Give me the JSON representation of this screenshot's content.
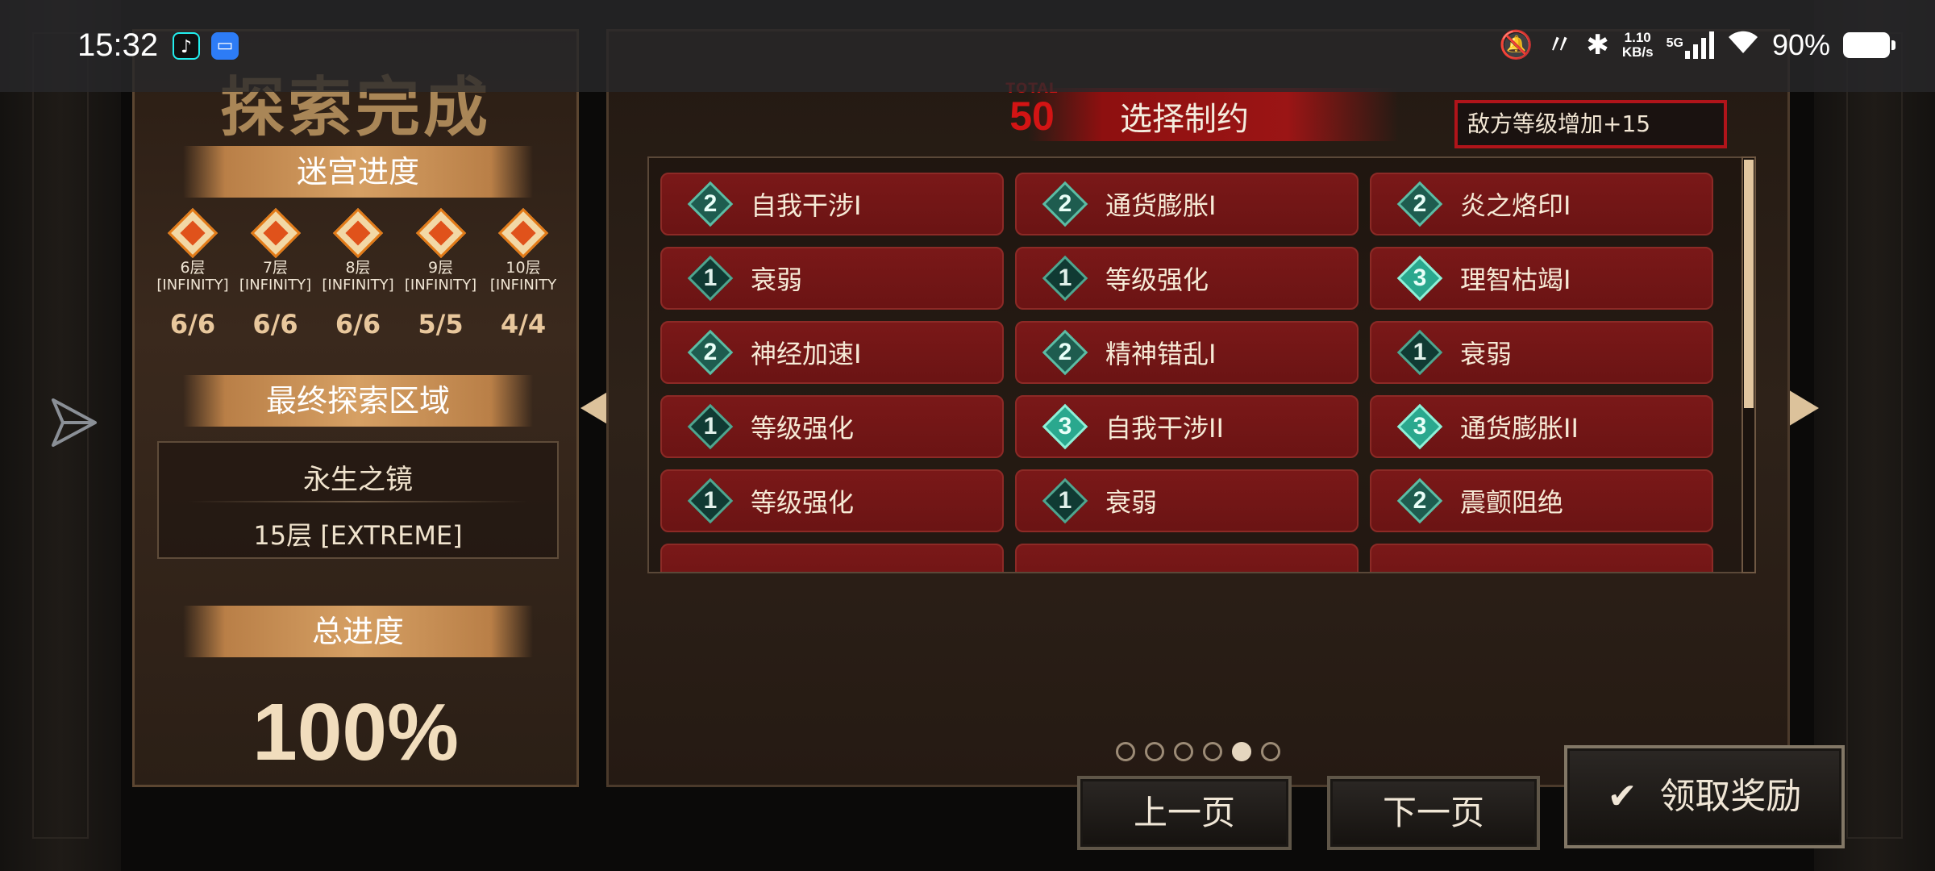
{
  "status_bar": {
    "time": "15:32",
    "net_speed_value": "1.10",
    "net_speed_unit": "KB/s",
    "network": "5G",
    "battery_pct": "90%",
    "icons": [
      "tiktok-icon",
      "screen-share-icon",
      "mute-icon",
      "nfc-icon",
      "bluetooth-icon",
      "signal-icon",
      "wifi-icon",
      "battery-icon"
    ]
  },
  "left": {
    "title": "探索完成",
    "maze_progress_label": "迷宫进度",
    "floors": [
      {
        "name": "6层",
        "difficulty": "[INFINITY]",
        "count": "6/6"
      },
      {
        "name": "7层",
        "difficulty": "[INFINITY]",
        "count": "6/6"
      },
      {
        "name": "8层",
        "difficulty": "[INFINITY]",
        "count": "6/6"
      },
      {
        "name": "9层",
        "difficulty": "[INFINITY]",
        "count": "5/5"
      },
      {
        "name": "10层",
        "difficulty": "[INFINITY",
        "count": "4/4"
      }
    ],
    "final_area_label": "最终探索区域",
    "area_name": "永生之镜",
    "area_floor": "15层 [EXTREME]",
    "total_progress_label": "总进度",
    "total_progress": "100%"
  },
  "main": {
    "total_label": "TOTAL",
    "total_value": "50",
    "header_title": "选择制约",
    "enemy_level": "敌方等级增加+15",
    "constraints": [
      {
        "level": "2",
        "label": "自我干涉I"
      },
      {
        "level": "2",
        "label": "通货膨胀I"
      },
      {
        "level": "2",
        "label": "炎之烙印I"
      },
      {
        "level": "1",
        "label": "衰弱"
      },
      {
        "level": "1",
        "label": "等级强化"
      },
      {
        "level": "3",
        "label": "理智枯竭I"
      },
      {
        "level": "2",
        "label": "神经加速I"
      },
      {
        "level": "2",
        "label": "精神错乱I"
      },
      {
        "level": "1",
        "label": "衰弱"
      },
      {
        "level": "1",
        "label": "等级强化"
      },
      {
        "level": "3",
        "label": "自我干涉II"
      },
      {
        "level": "3",
        "label": "通货膨胀II"
      },
      {
        "level": "1",
        "label": "等级强化"
      },
      {
        "level": "1",
        "label": "衰弱"
      },
      {
        "level": "2",
        "label": "震颤阻绝"
      }
    ],
    "scroll_fraction": 0.6,
    "page_count": 6,
    "current_page": 5
  },
  "buttons": {
    "prev": "上一页",
    "next": "下一页",
    "claim": "领取奖励"
  },
  "colors": {
    "card_red": "#7a1818",
    "accent_gold": "#d6a064",
    "total_red": "#d21414",
    "gem_teal": "#2aa88e"
  }
}
